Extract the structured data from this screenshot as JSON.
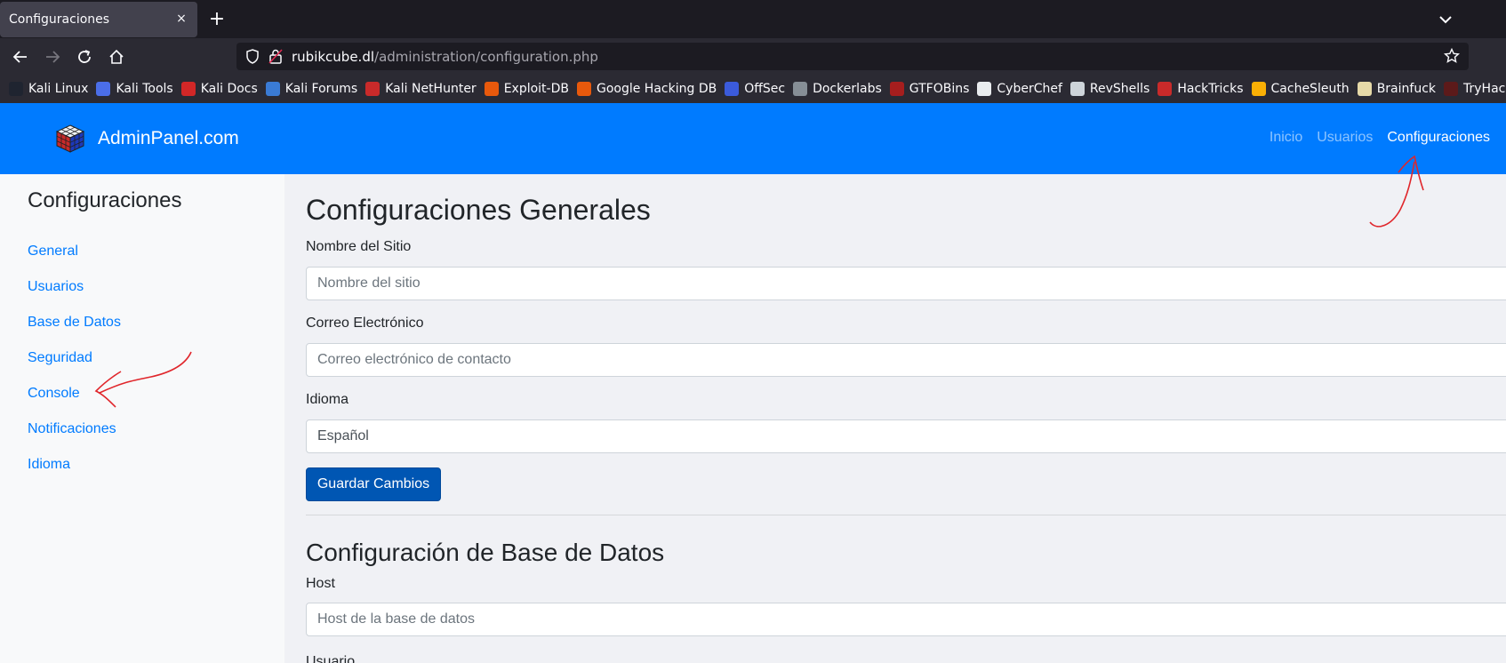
{
  "browser": {
    "tab": {
      "title": "Configuraciones",
      "close": "×"
    },
    "newtab": "+",
    "url": {
      "domain": "rubikcube.dl",
      "path": "/administration/configuration.php"
    },
    "bookmarks": [
      {
        "label": "Kali Linux",
        "icon": "kali-dragon-icon",
        "color": "#1f2430"
      },
      {
        "label": "Kali Tools",
        "icon": "kali-tools-icon",
        "color": "#4b6ee8"
      },
      {
        "label": "Kali Docs",
        "icon": "kali-docs-icon",
        "color": "#d22727"
      },
      {
        "label": "Kali Forums",
        "icon": "kali-forums-icon",
        "color": "#3a7bd5"
      },
      {
        "label": "Kali NetHunter",
        "icon": "nethunter-icon",
        "color": "#c92a2a"
      },
      {
        "label": "Exploit-DB",
        "icon": "exploitdb-icon",
        "color": "#e8590c"
      },
      {
        "label": "Google Hacking DB",
        "icon": "ghdb-icon",
        "color": "#e8590c"
      },
      {
        "label": "OffSec",
        "icon": "offsec-icon",
        "color": "#3b5bdb"
      },
      {
        "label": "Dockerlabs",
        "icon": "dockerlabs-icon",
        "color": "#868e96"
      },
      {
        "label": "GTFOBins",
        "icon": "gtfobins-icon",
        "color": "#a61e1e"
      },
      {
        "label": "CyberChef",
        "icon": "cyberchef-icon",
        "color": "#e9ecef"
      },
      {
        "label": "RevShells",
        "icon": "revshells-icon",
        "color": "#ced4da"
      },
      {
        "label": "HackTricks",
        "icon": "hacktricks-icon",
        "color": "#c92a2a"
      },
      {
        "label": "CacheSleuth",
        "icon": "cachesleuth-icon",
        "color": "#fab005"
      },
      {
        "label": "Brainfuck",
        "icon": "brainfuck-icon",
        "color": "#e6d9a8"
      },
      {
        "label": "TryHackMe",
        "icon": "tryhackme-icon",
        "color": "#5c1a1a"
      }
    ]
  },
  "site": {
    "brand": "AdminPanel.com",
    "nav": [
      {
        "label": "Inicio",
        "active": false
      },
      {
        "label": "Usuarios",
        "active": false
      },
      {
        "label": "Configuraciones",
        "active": true
      }
    ]
  },
  "sidebar": {
    "title": "Configuraciones",
    "items": [
      {
        "label": "General"
      },
      {
        "label": "Usuarios"
      },
      {
        "label": "Base de Datos"
      },
      {
        "label": "Seguridad"
      },
      {
        "label": "Console"
      },
      {
        "label": "Notificaciones"
      },
      {
        "label": "Idioma"
      }
    ]
  },
  "main": {
    "general": {
      "title": "Configuraciones Generales",
      "site_name": {
        "label": "Nombre del Sitio",
        "placeholder": "Nombre del sitio"
      },
      "email": {
        "label": "Correo Electrónico",
        "placeholder": "Correo electrónico de contacto"
      },
      "language": {
        "label": "Idioma",
        "value": "Español"
      },
      "save": "Guardar Cambios"
    },
    "database": {
      "title": "Configuración de Base de Datos",
      "host": {
        "label": "Host",
        "placeholder": "Host de la base de datos"
      },
      "user": {
        "label": "Usuario"
      }
    }
  },
  "colors": {
    "primary": "#007bff",
    "button": "#0056b3",
    "annotation": "#e0262b"
  }
}
